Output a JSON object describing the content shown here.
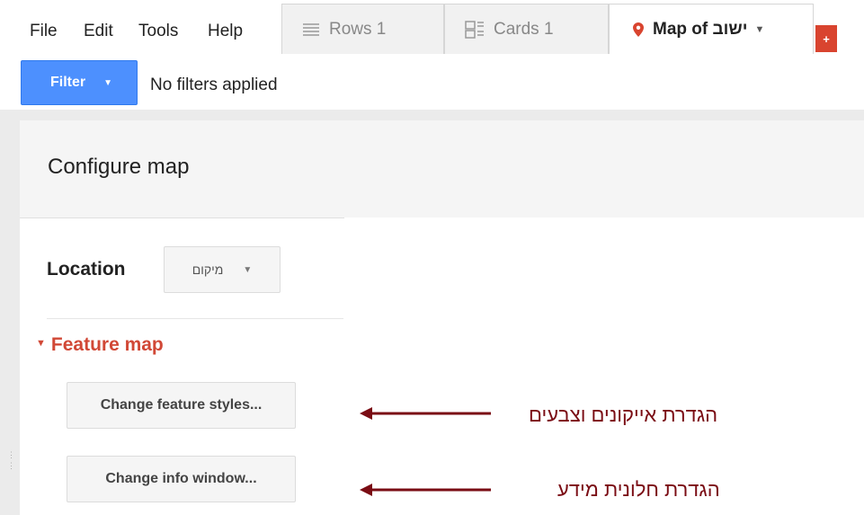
{
  "menu": [
    "File",
    "Edit",
    "Tools",
    "Help"
  ],
  "tabs": [
    {
      "label": "Rows 1",
      "icon": "rows-icon"
    },
    {
      "label": "Cards 1",
      "icon": "cards-icon"
    },
    {
      "label": "Map of ישוב",
      "icon": "map-pin-icon"
    }
  ],
  "add_tab_label": "+",
  "filter": {
    "button_label": "Filter",
    "status": "No filters applied"
  },
  "config": {
    "title": "Configure map"
  },
  "location": {
    "label": "Location",
    "selected": "מיקום"
  },
  "feature_map": {
    "title": "Feature map",
    "buttons": [
      "Change feature styles...",
      "Change info window..."
    ]
  },
  "annotations": [
    "הגדרת אייקונים וצבעים",
    "הגדרת חלונית מידע"
  ],
  "colors": {
    "accent_blue": "#4d90fe",
    "feature_red": "#d14836",
    "annotation": "#7a0c14",
    "add_tab": "#d9442f"
  }
}
